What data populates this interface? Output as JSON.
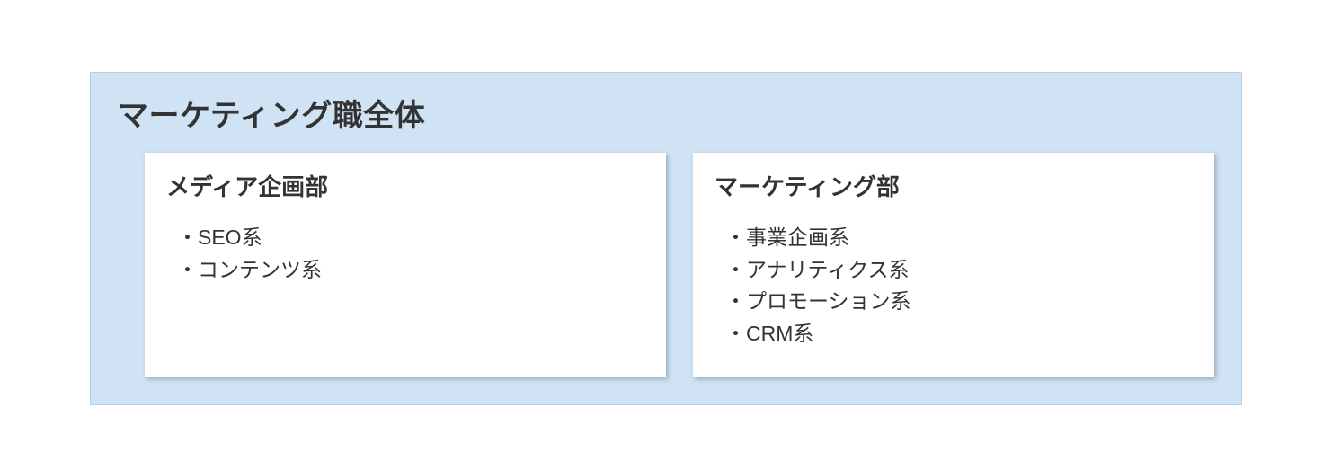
{
  "diagram": {
    "title": "マーケティング職全体",
    "groups": [
      {
        "title": "メディア企画部",
        "items": [
          "SEO系",
          "コンテンツ系"
        ]
      },
      {
        "title": "マーケティング部",
        "items": [
          "事業企画系",
          "アナリティクス系",
          "プロモーション系",
          "CRM系"
        ]
      }
    ]
  }
}
